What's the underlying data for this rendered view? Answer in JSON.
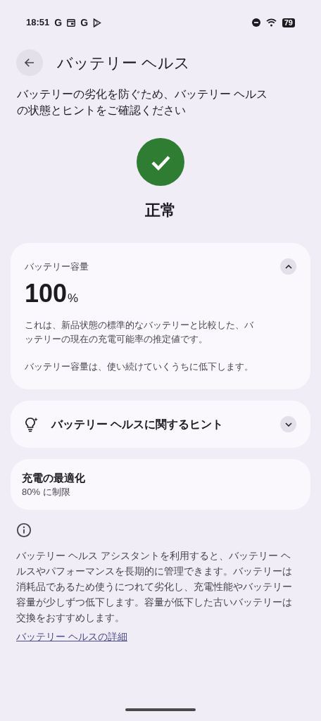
{
  "status_bar": {
    "time": "18:51",
    "notification_icons": [
      "G",
      "G"
    ],
    "battery": "79"
  },
  "header": {
    "title": "バッテリー ヘルス"
  },
  "description": "バッテリーの劣化を防ぐため、バッテリー ヘルスの状態とヒントをご確認ください",
  "status": {
    "label": "正常"
  },
  "cards": [
    {
      "kind": "capacity",
      "title": "バッテリー容量",
      "expanded": true,
      "value": "100",
      "unit": "%",
      "paragraphs": [
        "これは、新品状態の標準的なバッテリーと比較した、バッテリーの現在の充電可能率の推定値です。",
        "バッテリー容量は、使い続けていくうちに低下します。"
      ]
    },
    {
      "kind": "tips",
      "title": "バッテリー ヘルスに関するヒント",
      "expanded": false
    },
    {
      "kind": "setting",
      "title": "充電の最適化",
      "subtitle": "80% に制限"
    }
  ],
  "info": {
    "text": "バッテリー ヘルス アシスタントを利用すると、バッテリー ヘルスやパフォーマンスを長期的に管理できます。バッテリーは消耗品であるため使うにつれて劣化し、充電性能やバッテリー容量が少しずつ低下します。容量が低下した古いバッテリーは交換をおすすめします。",
    "link": "バッテリー ヘルスの詳細"
  }
}
